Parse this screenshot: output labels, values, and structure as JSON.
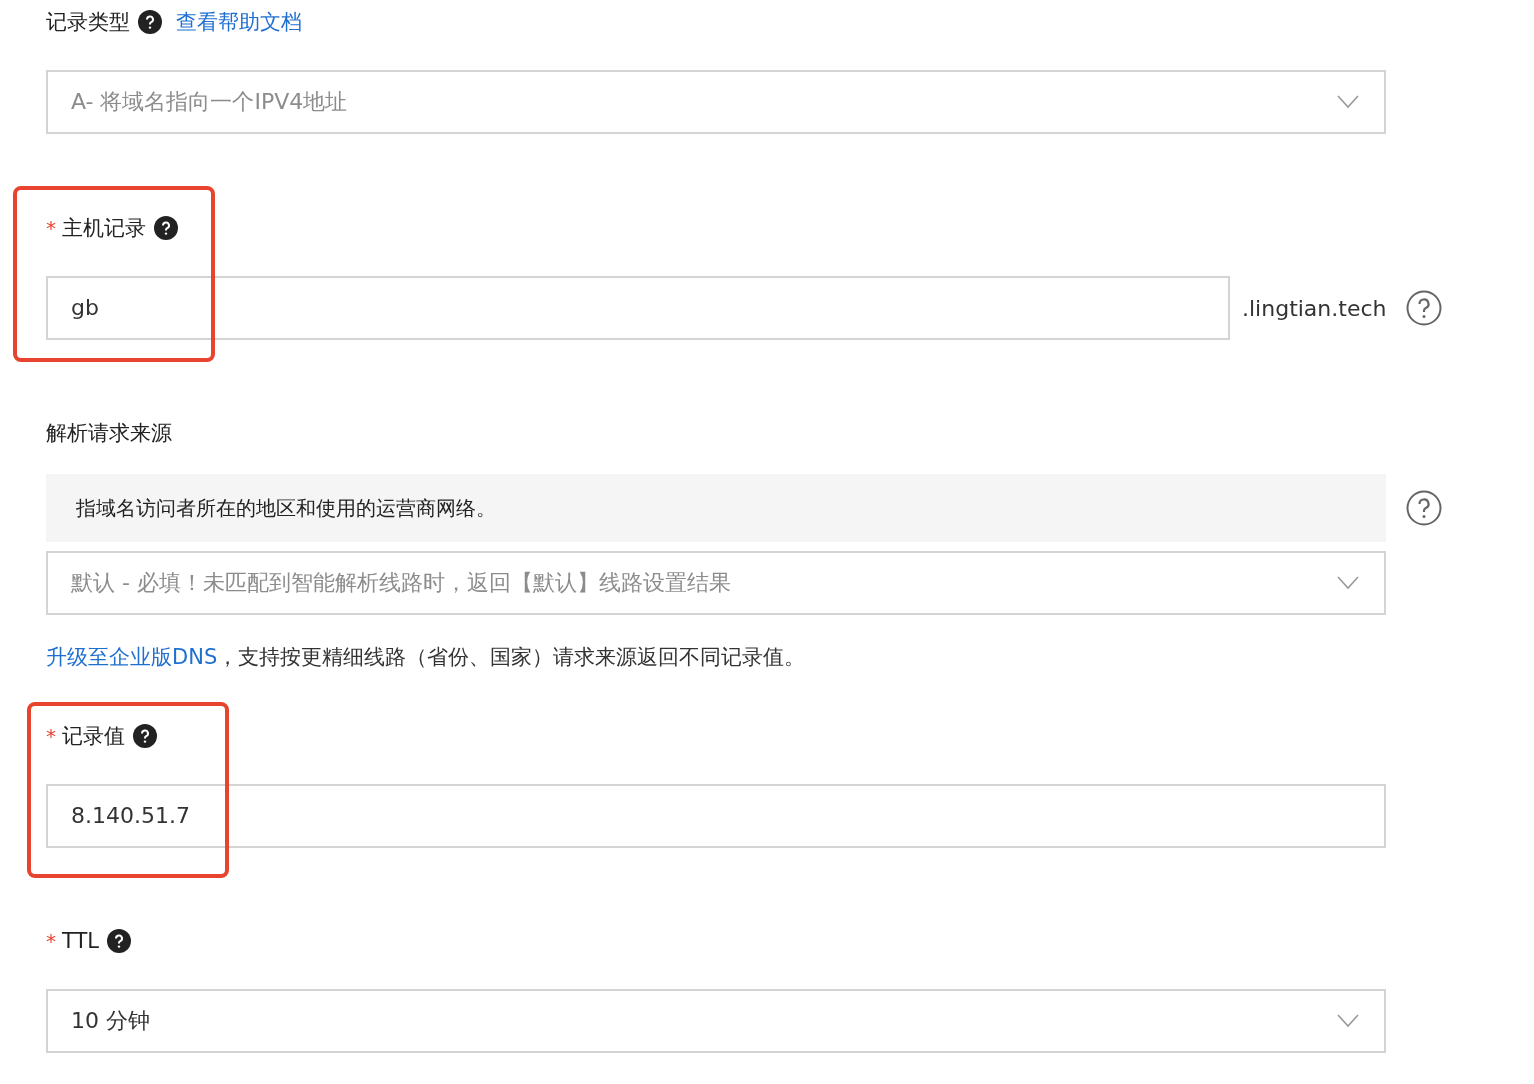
{
  "fields": [
    {
      "kind": "select",
      "label": "记录类型",
      "help_icon": true,
      "help_link": "查看帮助文档",
      "value": "A- 将域名指向一个IPV4地址",
      "muted": true
    },
    {
      "kind": "input",
      "required_mark": "*",
      "label": "主机记录",
      "help_icon": true,
      "value": "gb",
      "suffix": ".lingtian.tech",
      "side_help": true,
      "highlighted": true
    },
    {
      "kind": "select",
      "label": "解析请求来源",
      "info": "指域名访问者所在的地区和使用的运营商网络。",
      "info_help": true,
      "value": "默认 - 必填！未匹配到智能解析线路时，返回【默认】线路设置结果",
      "muted": true,
      "note_link": "升级至企业版DNS",
      "note": "，支持按更精细线路（省份、国家）请求来源返回不同记录值。"
    },
    {
      "kind": "input",
      "required_mark": "*",
      "label": "记录值",
      "help_icon": true,
      "value": "8.140.51.7",
      "highlighted": true
    },
    {
      "kind": "select",
      "required_mark": "*",
      "label": "TTL",
      "help_icon": true,
      "value": "10 分钟",
      "muted": false
    }
  ]
}
